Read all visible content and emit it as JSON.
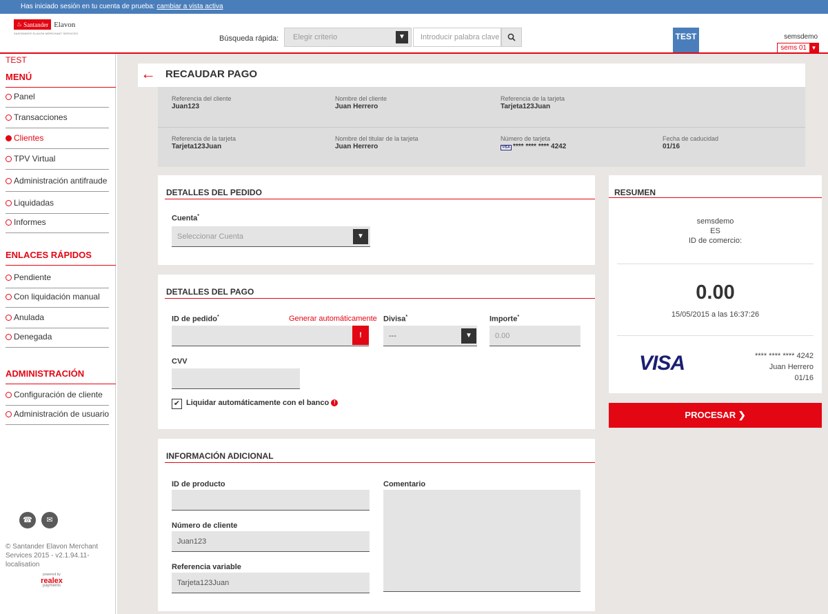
{
  "trial_bar": {
    "text": "Has iniciado sesión en tu cuenta de prueba: ",
    "link": "cambiar a vista activa"
  },
  "header": {
    "logo_santander": "Santander",
    "logo_elavon": "Elavon",
    "logo_sub": "SANTANDER ELAVON MERCHANT SERVICES",
    "search_label": "Búsqueda rápida:",
    "criteria_placeholder": "Elegir criterio",
    "keyword_placeholder": "Introducir palabra clave",
    "test_flag": "TEST",
    "user_name": "semsdemo",
    "user_account": "sems 01"
  },
  "sidebar": {
    "test_label": "TEST",
    "menu_title": "MENÚ",
    "menu_items": [
      {
        "label": "Panel"
      },
      {
        "label": "Transacciones"
      },
      {
        "label": "Clientes"
      },
      {
        "label": "TPV Virtual"
      },
      {
        "label": "Administración antifraude"
      },
      {
        "label": "Liquidadas"
      },
      {
        "label": "Informes"
      }
    ],
    "quick_title": "ENLACES RÁPIDOS",
    "quick_items": [
      {
        "label": "Pendiente"
      },
      {
        "label": "Con liquidación manual"
      },
      {
        "label": "Anulada"
      },
      {
        "label": "Denegada"
      }
    ],
    "admin_title": "ADMINISTRACIÓN",
    "admin_items": [
      {
        "label": "Configuración de cliente"
      },
      {
        "label": "Administración de usuario"
      }
    ],
    "copyright": "© Santander Elavon Merchant Services 2015 - v2.1.94.11-localisation",
    "powered_by": "powered by",
    "realex": "realex",
    "payments": "payments"
  },
  "page": {
    "title": "RECAUDAR PAGO"
  },
  "customer_info": {
    "row1": [
      {
        "label": "Referencia del cliente",
        "value": "Juan123"
      },
      {
        "label": "Nombre del cliente",
        "value": "Juan Herrero"
      },
      {
        "label": "Referencia de la tarjeta",
        "value": "Tarjeta123Juan"
      }
    ],
    "row2": [
      {
        "label": "Referencia de la tarjeta",
        "value": "Tarjeta123Juan"
      },
      {
        "label": "Nombre del titular de la tarjeta",
        "value": "Juan Herrero"
      },
      {
        "label": "Número de tarjeta",
        "value": "**** **** **** 4242",
        "visa_mark": "VISA"
      },
      {
        "label": "Fecha de caducidad",
        "value": "01/16"
      }
    ]
  },
  "order_details": {
    "title": "DETALLES DEL PEDIDO",
    "account_label": "Cuenta",
    "account_placeholder": "Seleccionar Cuenta"
  },
  "payment_details": {
    "title": "DETALLES DEL PAGO",
    "order_id_label": "ID de pedido",
    "generate_link": "Generar automáticamente",
    "currency_label": "Divisa",
    "currency_value": "---",
    "amount_label": "Importe",
    "amount_placeholder": "0.00",
    "cvv_label": "CVV",
    "auto_settle_label": "Liquidar automáticamente con el banco",
    "auto_settle_checked": true
  },
  "additional_info": {
    "title": "INFORMACIÓN ADICIONAL",
    "product_id_label": "ID de producto",
    "comment_label": "Comentario",
    "customer_number_label": "Número de cliente",
    "customer_number_value": "Juan123",
    "variable_ref_label": "Referencia variable",
    "variable_ref_value": "Tarjeta123Juan"
  },
  "summary": {
    "title": "RESUMEN",
    "merchant_name": "semsdemo",
    "merchant_country": "ES",
    "merchant_id_label": "ID de comercio:",
    "amount": "0.00",
    "datetime": "15/05/2015 a las 16:37:26",
    "card_brand": "VISA",
    "card_number": "**** **** **** 4242",
    "card_holder": "Juan Herrero",
    "card_expiry": "01/16"
  },
  "process_button": "PROCESAR ❯",
  "colors": {
    "accent": "#e30613",
    "topbar": "#4a7ebb",
    "background": "#e9e6e3",
    "visa": "#1a1f71"
  }
}
